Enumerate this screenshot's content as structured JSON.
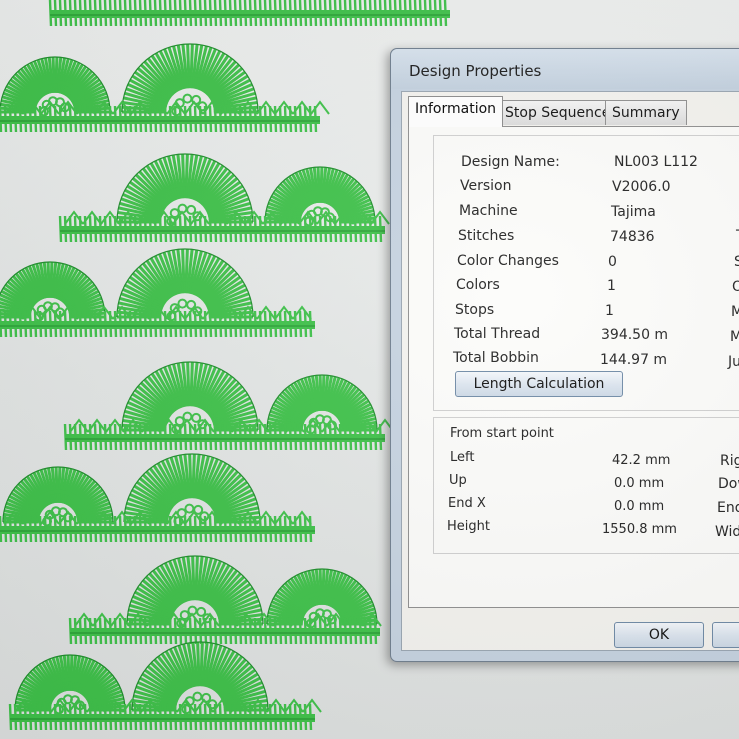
{
  "dialog": {
    "title": "Design Properties",
    "tabs": [
      {
        "label": "Information",
        "active": true
      },
      {
        "label": "Stop Sequence",
        "active": false
      },
      {
        "label": "Summary",
        "active": false
      }
    ],
    "info": [
      {
        "label": "Design Name:",
        "value": "NL003 L112"
      },
      {
        "label": "Version",
        "value": "V2006.0"
      },
      {
        "label": "Machine",
        "value": "Tajima"
      },
      {
        "label": "Stitches",
        "value": "74836"
      },
      {
        "label": "Color Changes",
        "value": "0"
      },
      {
        "label": "Colors",
        "value": "1"
      },
      {
        "label": "Stops",
        "value": "1"
      },
      {
        "label": "Total Thread",
        "value": "394.50 m"
      },
      {
        "label": "Total Bobbin",
        "value": "144.97 m"
      }
    ],
    "right_cut_labels_top": [
      "T",
      "S",
      "O",
      "M",
      "Mi",
      "Jur"
    ],
    "length_calculation_label": "Length Calculation",
    "start_point": {
      "heading": "From start point",
      "rows": [
        {
          "label": "Left",
          "value": "42.2 mm"
        },
        {
          "label": "Up",
          "value": "0.0 mm"
        },
        {
          "label": "End X",
          "value": "0.0 mm"
        },
        {
          "label": "Height",
          "value": "1550.8 mm"
        }
      ],
      "right_cut_labels": [
        "Righ",
        "Dow",
        "End",
        "Widt"
      ]
    },
    "ok_label": "OK"
  },
  "colors": {
    "thread": "#3fc24a",
    "thread_dark": "#1f8f2c",
    "dialog_frame": "#c6d3e1"
  }
}
